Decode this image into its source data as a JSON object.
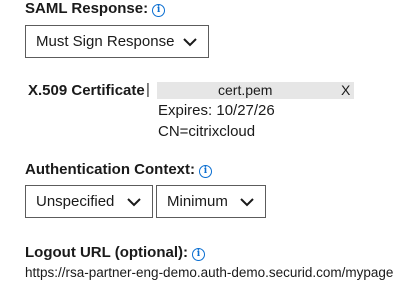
{
  "saml": {
    "label": "SAML Response:",
    "select_value": "Must Sign Response"
  },
  "certificate": {
    "label": "X.509 Certificate",
    "separator": "|",
    "file_name": "cert.pem",
    "remove_label": "X",
    "expires": "Expires: 10/27/26",
    "cn": "CN=citrixcloud"
  },
  "auth_context": {
    "label": "Authentication Context:",
    "class_value": "Unspecified",
    "comparison_value": "Minimum"
  },
  "logout": {
    "label": "Logout URL (optional):",
    "url": "https://rsa-partner-eng-demo.auth-demo.securid.com/mypage"
  },
  "icons": {
    "info": "info-icon",
    "dropdown": "chevron-down-icon"
  }
}
